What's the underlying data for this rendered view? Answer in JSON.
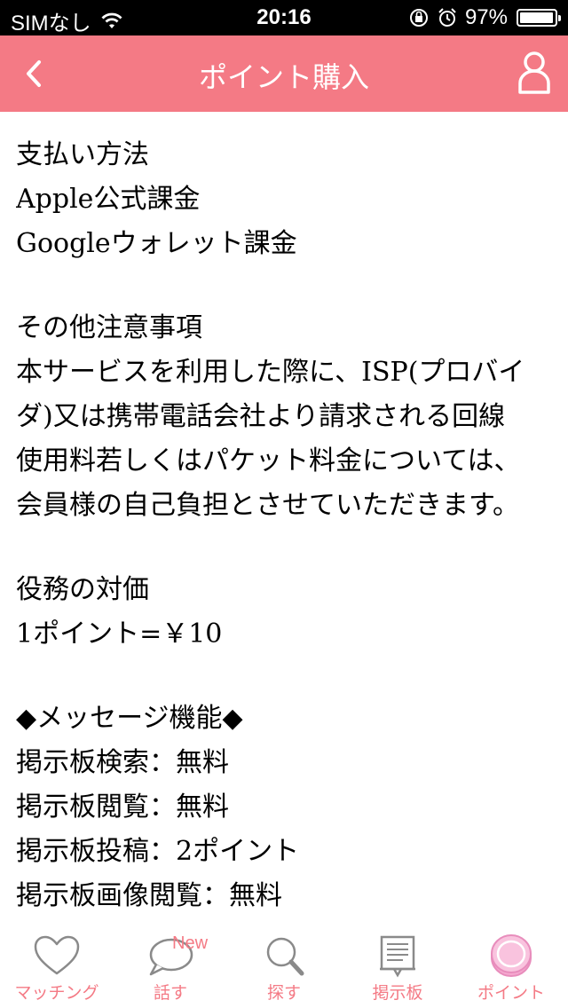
{
  "status_bar": {
    "carrier": "SIMなし",
    "time": "20:16",
    "battery_percent": "97%",
    "battery_level": 0.97
  },
  "nav": {
    "title": "ポイント購入"
  },
  "content": {
    "payment": {
      "heading": "支払い方法",
      "lines": [
        "Apple公式課金",
        "Googleウォレット課金"
      ]
    },
    "notes": {
      "heading": "その他注意事項",
      "lines": [
        "本サービスを利用した際に、ISP(プロバイ",
        "ダ)又は携帯電話会社より請求される回線",
        "使用料若しくはパケット料金については、",
        "会員様の自己負担とさせていただきます。"
      ]
    },
    "price": {
      "heading": "役務の対価",
      "lines": [
        "1ポイント=￥10"
      ]
    },
    "message_features": {
      "heading": "◆メッセージ機能◆",
      "lines": [
        "掲示板検索：無料",
        "掲示板閲覧：無料",
        "掲示板投稿：2ポイント",
        "掲示板画像閲覧：無料"
      ]
    }
  },
  "tab_bar": {
    "tabs": [
      {
        "label": "マッチング",
        "icon": "heart-icon"
      },
      {
        "label": "話す",
        "icon": "speech-bubble-icon",
        "badge": "New"
      },
      {
        "label": "探す",
        "icon": "search-icon"
      },
      {
        "label": "掲示板",
        "icon": "board-icon"
      },
      {
        "label": "ポイント",
        "icon": "coin-icon"
      }
    ]
  },
  "colors": {
    "accent": "#f47a85",
    "icon_gray": "#8a8a8a",
    "coin_pink": "#f6a9d0"
  }
}
